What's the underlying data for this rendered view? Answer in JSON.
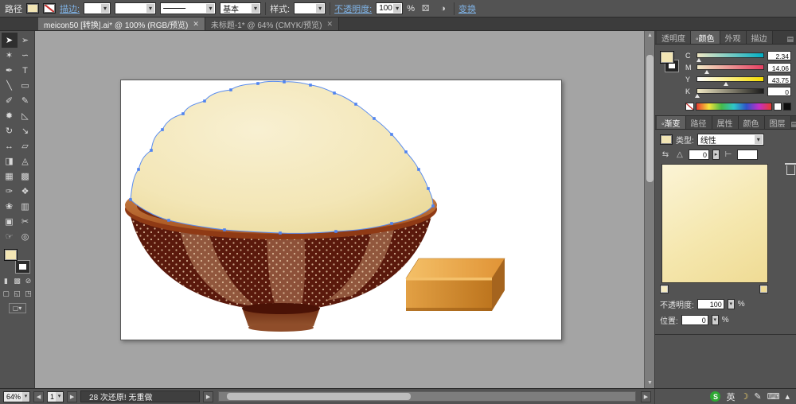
{
  "controlbar": {
    "context_label": "路径",
    "stroke_link": "描边:",
    "brush_value": "———",
    "basic_value": "基本",
    "style_label": "样式:",
    "opacity_link": "不透明度:",
    "opacity_value": "100",
    "percent": "%",
    "transform_link": "变换"
  },
  "doc_tabs": [
    {
      "label": "meicon50 [转换].ai* @ 100% (RGB/预览)",
      "close": "✕",
      "active": true
    },
    {
      "label": "未标题-1* @ 64% (CMYK/预览)",
      "close": "✕",
      "active": false
    }
  ],
  "tools": [
    {
      "name": "selection-tool",
      "glyph": "➤"
    },
    {
      "name": "direct-selection-tool",
      "glyph": "➢"
    },
    {
      "name": "magic-wand-tool",
      "glyph": "✶"
    },
    {
      "name": "lasso-tool",
      "glyph": "∽"
    },
    {
      "name": "pen-tool",
      "glyph": "✒"
    },
    {
      "name": "type-tool",
      "glyph": "T"
    },
    {
      "name": "line-tool",
      "glyph": "╲"
    },
    {
      "name": "rectangle-tool",
      "glyph": "▭"
    },
    {
      "name": "paintbrush-tool",
      "glyph": "✐"
    },
    {
      "name": "pencil-tool",
      "glyph": "✎"
    },
    {
      "name": "blob-brush-tool",
      "glyph": "✹"
    },
    {
      "name": "eraser-tool",
      "glyph": "◺"
    },
    {
      "name": "rotate-tool",
      "glyph": "↻"
    },
    {
      "name": "scale-tool",
      "glyph": "↘"
    },
    {
      "name": "width-tool",
      "glyph": "↔"
    },
    {
      "name": "free-transform-tool",
      "glyph": "▱"
    },
    {
      "name": "shape-builder-tool",
      "glyph": "◨"
    },
    {
      "name": "perspective-grid-tool",
      "glyph": "◬"
    },
    {
      "name": "mesh-tool",
      "glyph": "▦"
    },
    {
      "name": "gradient-tool",
      "glyph": "▩"
    },
    {
      "name": "eyedropper-tool",
      "glyph": "✑"
    },
    {
      "name": "blend-tool",
      "glyph": "❖"
    },
    {
      "name": "symbol-sprayer-tool",
      "glyph": "❀"
    },
    {
      "name": "column-graph-tool",
      "glyph": "▥"
    },
    {
      "name": "artboard-tool",
      "glyph": "▣"
    },
    {
      "name": "slice-tool",
      "glyph": "✂"
    },
    {
      "name": "hand-tool",
      "glyph": "☞"
    },
    {
      "name": "zoom-tool",
      "glyph": "◎"
    }
  ],
  "panels": {
    "top_tabs": [
      {
        "label": "透明度",
        "active": false
      },
      {
        "label": "◦颜色",
        "active": true
      },
      {
        "label": "外观",
        "active": false
      },
      {
        "label": "描边",
        "active": false
      }
    ],
    "color": {
      "channels": [
        {
          "label": "C",
          "value": "2.34",
          "pos": 2.3,
          "from": "#F0E8C4",
          "to": "#00AEC4"
        },
        {
          "label": "M",
          "value": "14.06",
          "pos": 14,
          "from": "#F0E8C4",
          "to": "#E63E62"
        },
        {
          "label": "Y",
          "value": "43.75",
          "pos": 43.7,
          "from": "#FFFFFF",
          "to": "#F5DC00"
        },
        {
          "label": "K",
          "value": "0",
          "pos": 0,
          "from": "#F0E8C4",
          "to": "#1A1A1A"
        }
      ]
    },
    "mid_tabs": [
      {
        "label": "◦渐变",
        "active": true
      },
      {
        "label": "路径",
        "active": false
      },
      {
        "label": "属性",
        "active": false
      },
      {
        "label": "颜色",
        "active": false
      },
      {
        "label": "图层",
        "active": false
      }
    ],
    "gradient": {
      "type_label": "类型:",
      "type_value": "线性",
      "angle_value": "0",
      "opacity_label": "不透明度:",
      "opacity_value": "100",
      "position_label": "位置:",
      "position_value": "0",
      "percent": "%"
    }
  },
  "statusbar": {
    "zoom": "64%",
    "page": "1",
    "history": "28 次还原! 无重做"
  },
  "taskbar": {
    "items": [
      {
        "name": "sogou-icon",
        "glyph": "S"
      },
      {
        "name": "lang-indicator",
        "glyph": "英"
      },
      {
        "name": "moon-icon",
        "glyph": "☽"
      },
      {
        "name": "pen-icon",
        "glyph": "✎"
      },
      {
        "name": "keyboard-icon",
        "glyph": "⌨"
      },
      {
        "name": "tray-collapse-icon",
        "glyph": "▴"
      }
    ]
  },
  "artwork": {
    "colors": {
      "rice": "#F3E7BB",
      "rice_highlight": "#F8F0D2",
      "rim_light": "#D08A4C",
      "rim_dark": "#8F3A15",
      "bowl_body": "#5A190C",
      "bowl_stripe": "#C08A66",
      "foot": "#8A4526",
      "box_top": "#F2BA60",
      "box_front": "#E09B3E",
      "box_side": "#A5641E",
      "selection_blue": "#4F83F0"
    }
  }
}
